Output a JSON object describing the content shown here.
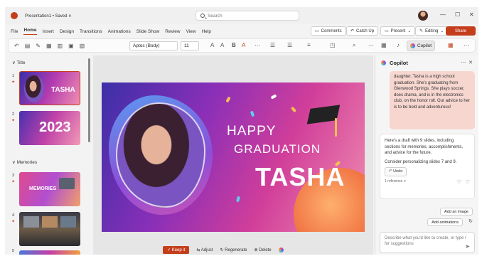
{
  "title_bar": {
    "file_title": "Presentation1 • Saved ∨",
    "search_placeholder": "Search",
    "controls": [
      "—",
      "☐",
      "✕"
    ]
  },
  "menu": {
    "items": [
      "File",
      "Home",
      "Insert",
      "Design",
      "Transitions",
      "Animations",
      "Slide Show",
      "Review",
      "View",
      "Help"
    ],
    "active": "Home",
    "comments_label": "Comments",
    "catchup_label": "Catch Up",
    "present_label": "Present",
    "editing_label": "Editing",
    "share_label": "Share"
  },
  "ribbon": {
    "font_name": "Aptos (Body)",
    "font_size": "11",
    "copilot_label": "Copilot"
  },
  "thumbnails": {
    "section_title": "Title",
    "section_memories": "Memories",
    "slides": [
      {
        "num": "1",
        "label": "TASHA"
      },
      {
        "num": "2",
        "label": "2023"
      },
      {
        "num": "3",
        "label": "MEMORIES"
      },
      {
        "num": "4",
        "label": ""
      },
      {
        "num": "5",
        "label": ""
      }
    ]
  },
  "slide": {
    "line1": "HAPPY",
    "line2": "GRADUATION",
    "name": "TASHA"
  },
  "actions": {
    "keep": "Keep it",
    "adjust": "Adjust",
    "regenerate": "Regenerate",
    "delete": "Delete"
  },
  "copilot": {
    "title": "Copilot",
    "user_message": "daughter. Tasha is a high school graduation. She's graduating from Glenwood Springs. She plays soccer, does drama, and is in the electronics club, on the honor roll. Our advice to her is to be bold and adventurous!",
    "reply_1": "Here's a draft with 9 slides, including sections for memories, accomplishments, and advice for the future.",
    "reply_2": "Consider personalizing slides 7 and 9.",
    "undo_label": "Undo",
    "reference_label": "1 reference",
    "suggestion_1": "Add an image",
    "suggestion_2": "Add animations",
    "prompt_placeholder": "Describe what you'd like to create, or type / for suggestions"
  },
  "colors": {
    "accent": "#c43e1c"
  }
}
